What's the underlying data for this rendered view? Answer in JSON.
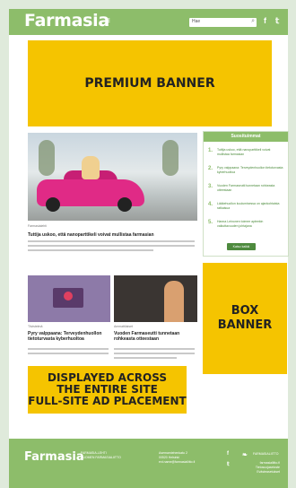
{
  "header": {
    "logo": "Farmasia",
    "menu_icon": "hamburger-icon",
    "search_placeholder": "Hae",
    "search_icon": "search-icon",
    "social": [
      "facebook-icon",
      "twitter-icon"
    ]
  },
  "banners": {
    "premium": "PREMIUM BANNER",
    "box": [
      "BOX",
      "BANNER"
    ],
    "fullsite": [
      "DISPLAYED ACROSS",
      "THE ENTIRE SITE",
      "FULL-SITE AD PLACEMENT"
    ]
  },
  "articles": [
    {
      "category": "Farmasialehti",
      "title": "Tuttija uskoo, että nanoparttikeli voivat mullistaa farmasian"
    },
    {
      "category": "Tiivistelmä",
      "title": "Pyry valppaana: Terveydenhuollon tietoturvasta kyberhuoltoa"
    },
    {
      "category": "Ammattilaiset",
      "title": "Vuoden Farmaseutti tunnetaan rohkeasta otteestaan"
    }
  ],
  "sidebar": {
    "title": "Suosituimmat",
    "items": [
      {
        "num": "1.",
        "text": "Tuttija uskoo, että nanoparttikeli voivat mullistaa farmasian"
      },
      {
        "num": "2.",
        "text": "Pyry valppaana: Terveydenhuollon tietoturvasta kyberhuoltoa"
      },
      {
        "num": "3.",
        "text": "Vuoden Farmaseutti tunnetaan rohkeasta otteestaan"
      },
      {
        "num": "4.",
        "text": "Lääkehuollon kuulumisessa on ajankohtaista ratkaisua"
      },
      {
        "num": "5.",
        "text": "Hanna Leinonen toimee apteekin vaikuttavuuden johtajana"
      }
    ],
    "button": "Katso kaikki"
  },
  "footer": {
    "logo": "Farmasia",
    "col1": [
      "FARMASIA-LEHTI",
      "SUOMEN FARMASIALIITTO"
    ],
    "col2": [
      "Asemamiehenkatu 2",
      "00520 Helsinki",
      "ext.name@farmasialiitto.fi"
    ],
    "col3_icons": [
      "facebook-icon",
      "twitter-icon"
    ],
    "col4_label": "FARMASIALIITTO",
    "col4_icon": "leaf-icon",
    "col4_links": [
      "farmasialiitto.fi",
      "Tietosuojaseloste",
      "Evästeasetukset"
    ]
  }
}
